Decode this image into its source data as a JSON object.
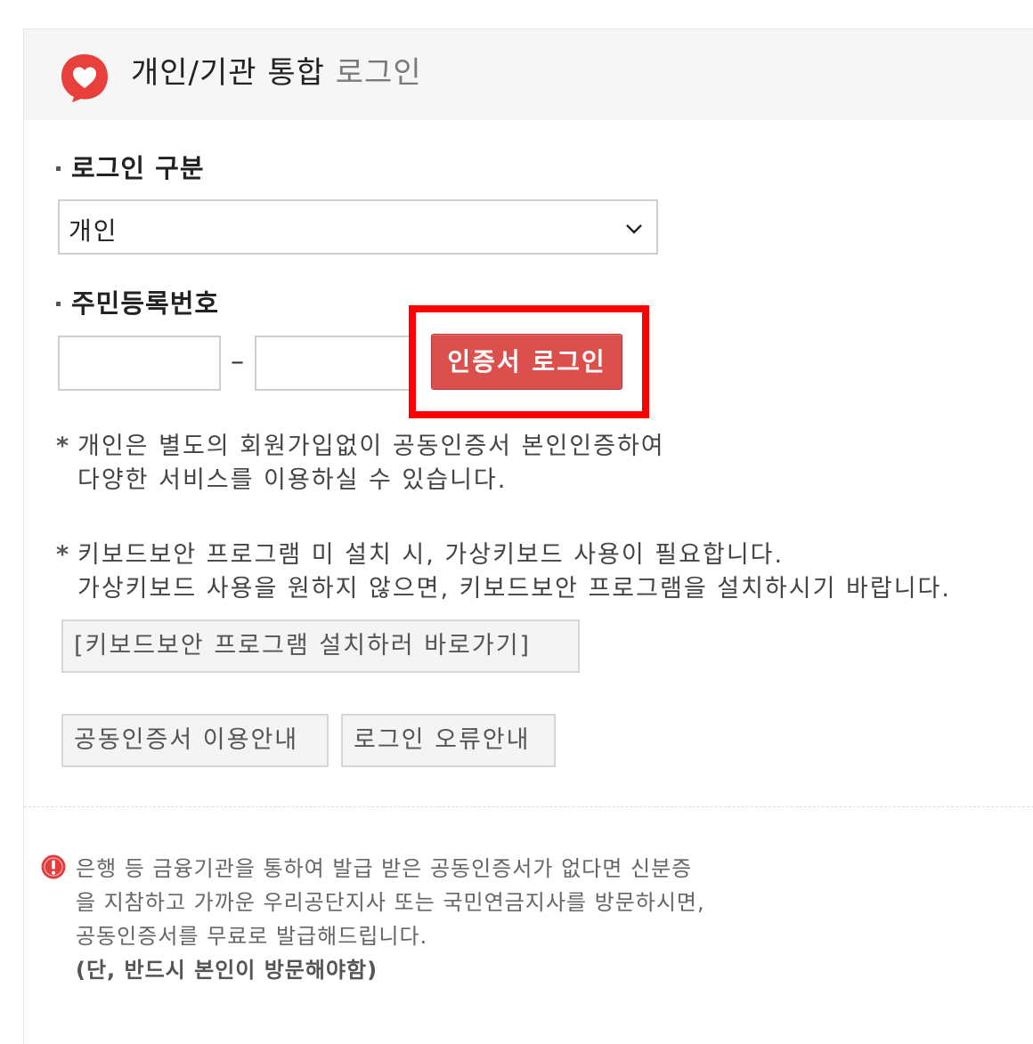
{
  "header": {
    "title": "개인/기관 통합",
    "title_sub": "로그인"
  },
  "login_type": {
    "label": "로그인 구분",
    "selected_value": "개인"
  },
  "resident_number": {
    "label": "주민등록번호",
    "first_value": "",
    "second_value": "",
    "separator": "–"
  },
  "cert_login_button": "인증서 로그인",
  "notes": {
    "star": "*",
    "note1_line1": "개인은 별도의 회원가입없이 공동인증서 본인인증하여",
    "note1_line2": "다양한 서비스를 이용하실 수 있습니다.",
    "note2_line1": "키보드보안 프로그램 미 설치 시, 가상키보드 사용이 필요합니다.",
    "note2_line2": "가상키보드 사용을 원하지 않으면, 키보드보안 프로그램을 설치하시기 바랍니다."
  },
  "buttons": {
    "keyboard_install": "[키보드보안 프로그램 설치하러 바로가기]",
    "cert_guide": "공동인증서 이용안내",
    "login_error_guide": "로그인 오류안내"
  },
  "info": {
    "line1": "은행 등 금융기관을 통하여 발급 받은 공동인증서가 없다면 신분증",
    "line2": "을 지참하고 가까운 우리공단지사 또는 국민연금지사를 방문하시면,",
    "line3": "공동인증서를 무료로 발급해드립니다.",
    "line4": "(단, 반드시 본인이 방문해야함)"
  },
  "colors": {
    "accent_red": "#db4f4d",
    "highlight_red": "#ff0000",
    "logo_red": "#e8413c"
  },
  "icons": {
    "logo": "heart-speech-bubble-icon",
    "dropdown": "chevron-down-icon",
    "info": "exclamation-circle-icon"
  }
}
